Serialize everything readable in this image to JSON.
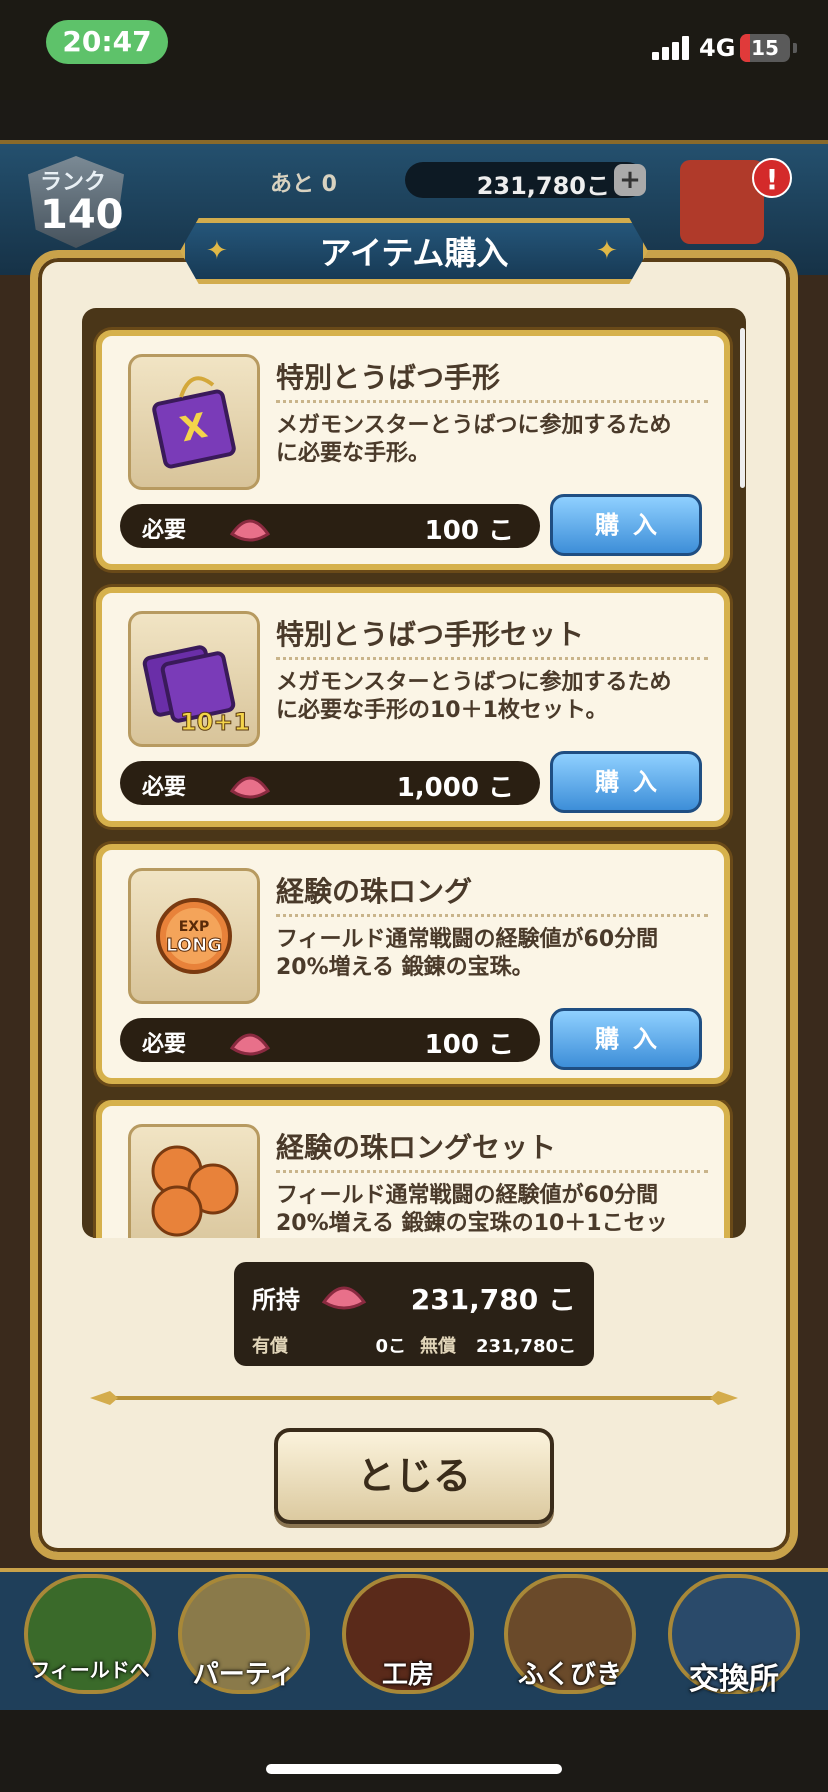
{
  "status_bar": {
    "time": "20:47",
    "network": "4G",
    "battery": "15"
  },
  "header": {
    "rank_label": "ランク",
    "rank_value": "140",
    "remaining_label": "あと 0",
    "gem_count": "231,780こ",
    "plus": "+",
    "alert": "!"
  },
  "dialog": {
    "title": "アイテム購入",
    "required_label": "必要",
    "buy_label": "購入",
    "items": [
      {
        "name": "特別とうばつ手形",
        "desc_line1": "メガモンスターとうばつに参加するため",
        "desc_line2": "に必要な手形。",
        "cost": "100 こ"
      },
      {
        "name": "特別とうばつ手形セット",
        "desc_line1": "メガモンスターとうばつに参加するため",
        "desc_line2": "に必要な手形の10＋1枚セット。",
        "cost": "1,000 こ"
      },
      {
        "name": "経験の珠ロング",
        "desc_line1": "フィールド通常戦闘の経験値が60分間",
        "desc_line2": "20%増える 鍛錬の宝珠。",
        "cost": "100 こ"
      },
      {
        "name": "経験の珠ロングセット",
        "desc_line1": "フィールド通常戦闘の経験値が60分間",
        "desc_line2": "20%増える 鍛錬の宝珠の10＋1こセッ",
        "cost": ""
      }
    ],
    "owned": {
      "label": "所持",
      "value": "231,780 こ",
      "paid_label": "有償",
      "paid_value": "0こ",
      "free_label": "無償",
      "free_value": "231,780こ"
    },
    "close_label": "とじる"
  },
  "nav": [
    {
      "label": "フィールドへ"
    },
    {
      "label": "パーティ"
    },
    {
      "label": "工房"
    },
    {
      "label": "ふくびき"
    },
    {
      "label": "交換所"
    }
  ],
  "colors": {
    "accent_gold": "#c9a24a",
    "buy_blue": "#3d8ed8",
    "panel_cream": "#f4ecd8"
  }
}
